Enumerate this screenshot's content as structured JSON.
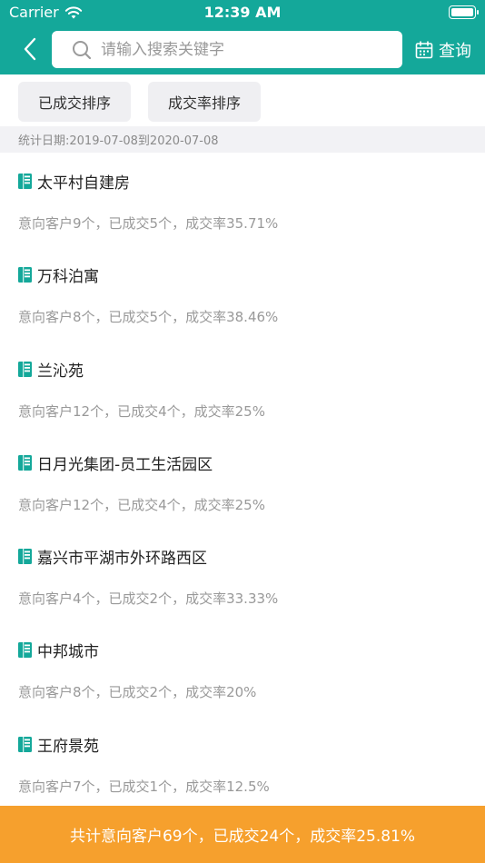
{
  "status_bar": {
    "carrier": "Carrier",
    "time": "12:39 AM",
    "battery_level": 1.0
  },
  "header": {
    "search": {
      "placeholder": "请输入搜索关键字",
      "value": ""
    },
    "query_label": "查询",
    "icons": {
      "back": "chevron-left-icon",
      "search": "search-icon",
      "calendar": "calendar-icon"
    }
  },
  "sort": {
    "by_deals": "已成交排序",
    "by_rate": "成交率排序"
  },
  "date_range": "统计日期:2019-07-08到2020-07-08",
  "items": [
    {
      "title": "太平村自建房",
      "stats": "意向客户9个，已成交5个，成交率35.71%"
    },
    {
      "title": "万科泊寓",
      "stats": "意向客户8个，已成交5个，成交率38.46%"
    },
    {
      "title": "兰沁苑",
      "stats": "意向客户12个，已成交4个，成交率25%"
    },
    {
      "title": "日月光集团-员工生活园区",
      "stats": "意向客户12个，已成交4个，成交率25%"
    },
    {
      "title": "嘉兴市平湖市外环路西区",
      "stats": "意向客户4个，已成交2个，成交率33.33%"
    },
    {
      "title": "中邦城市",
      "stats": "意向客户8个，已成交2个，成交率20%"
    },
    {
      "title": "王府景苑",
      "stats": "意向客户7个，已成交1个，成交率12.5%"
    }
  ],
  "summary": "共计意向客户69个，已成交24个，成交率25.81%",
  "colors": {
    "header": "#14a89a",
    "footer": "#f6a02d",
    "building_icon": "#14a89a"
  }
}
